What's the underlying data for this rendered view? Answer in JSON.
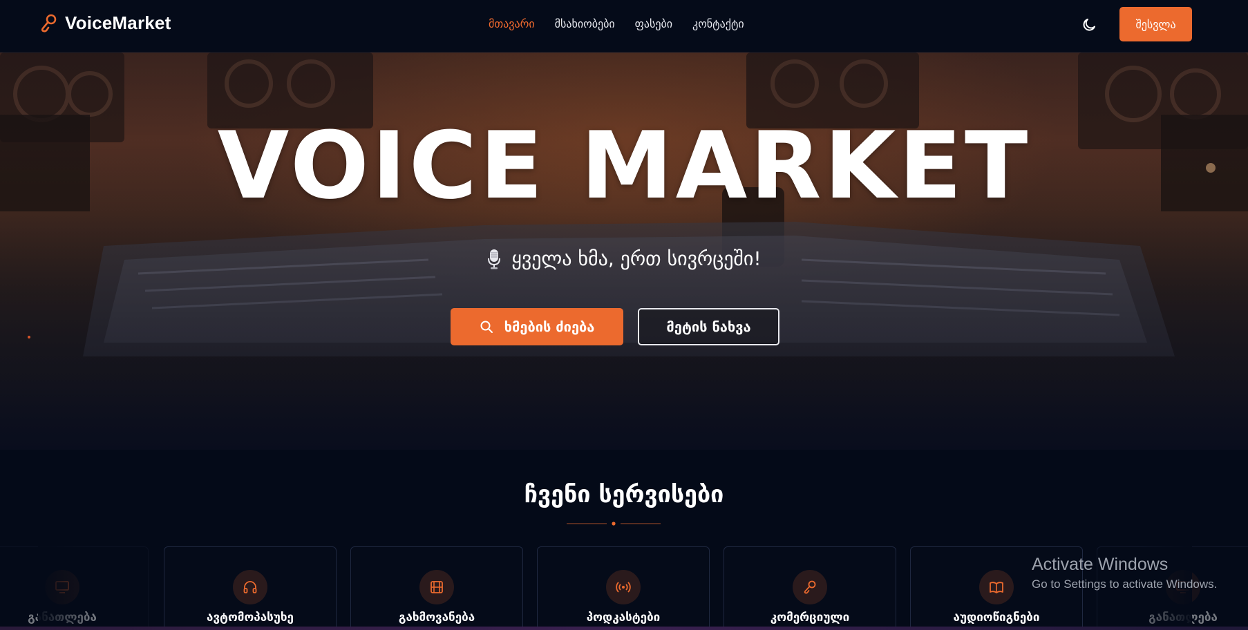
{
  "nav": {
    "brand": "VoiceMarket",
    "links": [
      {
        "label": "მთავარი",
        "active": true
      },
      {
        "label": "მსახიობები",
        "active": false
      },
      {
        "label": "ფასები",
        "active": false
      },
      {
        "label": "კონტაქტი",
        "active": false
      }
    ],
    "theme_icon": "moon-icon",
    "login_label": "შესვლა"
  },
  "hero": {
    "title": "VOICE MARKET",
    "subtitle": "ყველა ხმა, ერთ სივრცეში!",
    "search_button": "ხმების ძიება",
    "more_button": "მეტის ნახვა"
  },
  "services": {
    "title": "ჩვენი სერვისები",
    "cards": [
      {
        "label": "განათლება",
        "icon": "monitor-icon"
      },
      {
        "label": "ავტომოპასუხე",
        "icon": "headphones-icon"
      },
      {
        "label": "გახმოვანება",
        "icon": "film-icon"
      },
      {
        "label": "პოდკასტები",
        "icon": "broadcast-icon"
      },
      {
        "label": "კომერციული",
        "icon": "microphone-icon"
      },
      {
        "label": "აუდიოწიგნები",
        "icon": "book-icon"
      },
      {
        "label": "განათლება",
        "icon": "monitor-icon"
      }
    ]
  },
  "watermark": {
    "title": "Activate Windows",
    "subtitle": "Go to Settings to activate Windows."
  },
  "colors": {
    "accent": "#ec6a2e",
    "background": "#040a18"
  }
}
